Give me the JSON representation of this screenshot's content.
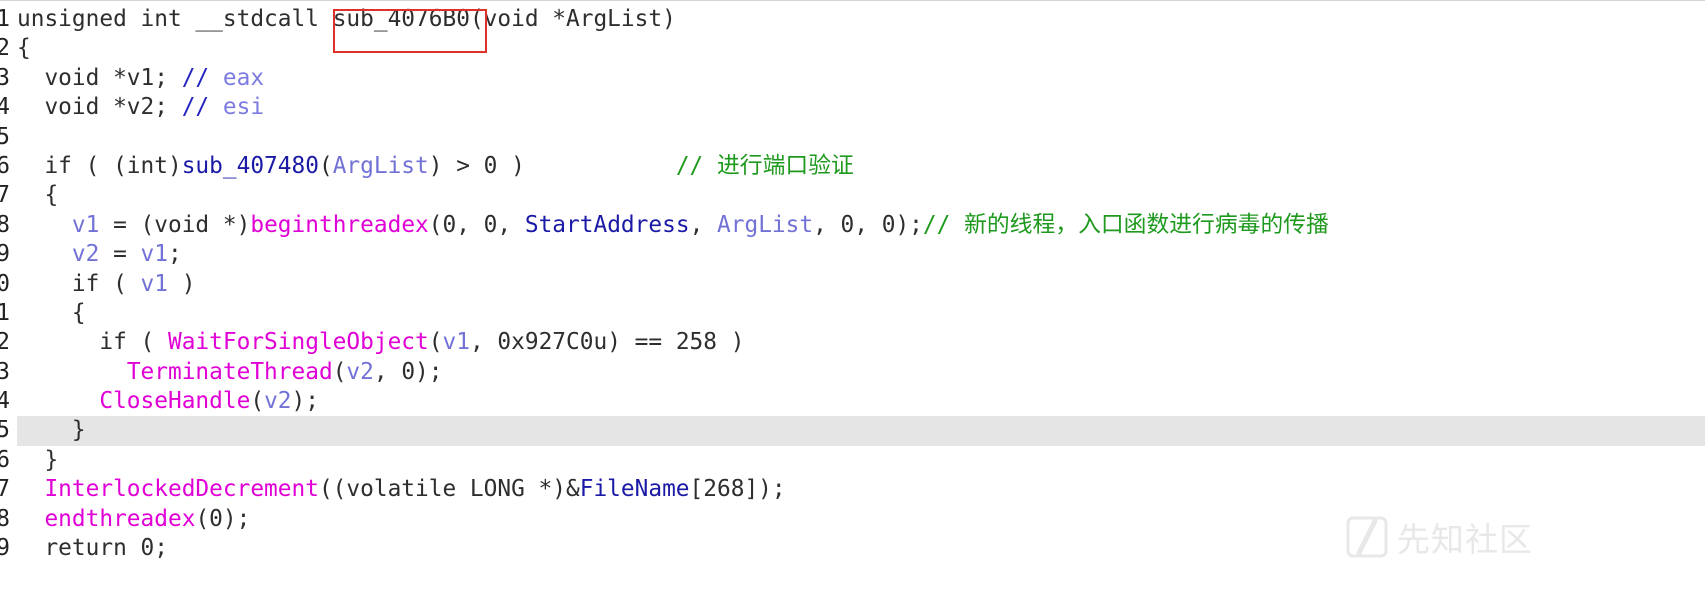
{
  "colors": {
    "plain": "#2e2e2e",
    "fname": "#2e2e2e",
    "name": "#1a1aa6",
    "import": "#e000d6",
    "var": "#7272d6",
    "comment": "#1f9a1f",
    "regslash": "#2323c0",
    "reg": "#7c7ce0",
    "highlight": "#e5e5e5",
    "annotation": "#e0302a",
    "watermark": "#e8e8e8"
  },
  "code": {
    "lines": [
      {
        "number": "1",
        "tokens": [
          {
            "plain": "unsigned int __stdcall "
          },
          {
            "fname": "sub_4076B0"
          },
          {
            "plain": "(void *ArgList)"
          }
        ]
      },
      {
        "number": "2",
        "tokens": [
          {
            "plain": "{"
          }
        ]
      },
      {
        "number": "3",
        "tokens": [
          {
            "plain": "  void *v1; "
          },
          {
            "regslash": "// "
          },
          {
            "reg": "eax"
          }
        ]
      },
      {
        "number": "4",
        "tokens": [
          {
            "plain": "  void *v2; "
          },
          {
            "regslash": "// "
          },
          {
            "reg": "esi"
          }
        ]
      },
      {
        "number": "5",
        "tokens": []
      },
      {
        "number": "6",
        "tokens": [
          {
            "plain": "  if ( (int)"
          },
          {
            "name": "sub_407480"
          },
          {
            "plain": "("
          },
          {
            "var": "ArgList"
          },
          {
            "plain": ") > 0 )           "
          },
          {
            "comment": "// 进行端口验证"
          }
        ]
      },
      {
        "number": "7",
        "tokens": [
          {
            "plain": "  {"
          }
        ]
      },
      {
        "number": "8",
        "tokens": [
          {
            "plain": "    "
          },
          {
            "var": "v1"
          },
          {
            "plain": " = (void *)"
          },
          {
            "import": "beginthreadex"
          },
          {
            "plain": "(0, 0, "
          },
          {
            "name": "StartAddress"
          },
          {
            "plain": ", "
          },
          {
            "var": "ArgList"
          },
          {
            "plain": ", 0, 0);"
          },
          {
            "comment": "// 新的线程，入口函数进行病毒的传播"
          }
        ]
      },
      {
        "number": "9",
        "tokens": [
          {
            "plain": "    "
          },
          {
            "var": "v2"
          },
          {
            "plain": " = "
          },
          {
            "var": "v1"
          },
          {
            "plain": ";"
          }
        ]
      },
      {
        "number": "0",
        "tokens": [
          {
            "plain": "    if ( "
          },
          {
            "var": "v1"
          },
          {
            "plain": " )"
          }
        ]
      },
      {
        "number": "1",
        "tokens": [
          {
            "plain": "    {"
          }
        ]
      },
      {
        "number": "2",
        "tokens": [
          {
            "plain": "      if ( "
          },
          {
            "import": "WaitForSingleObject"
          },
          {
            "plain": "("
          },
          {
            "var": "v1"
          },
          {
            "plain": ", 0x927C0u) == 258 )"
          }
        ]
      },
      {
        "number": "3",
        "tokens": [
          {
            "plain": "        "
          },
          {
            "import": "TerminateThread"
          },
          {
            "plain": "("
          },
          {
            "var": "v2"
          },
          {
            "plain": ", 0);"
          }
        ]
      },
      {
        "number": "4",
        "tokens": [
          {
            "plain": "      "
          },
          {
            "import": "CloseHandle"
          },
          {
            "plain": "("
          },
          {
            "var": "v2"
          },
          {
            "plain": ");"
          }
        ]
      },
      {
        "number": "5",
        "highlighted": true,
        "tokens": [
          {
            "plain": "    }"
          }
        ]
      },
      {
        "number": "6",
        "tokens": [
          {
            "plain": "  }"
          }
        ]
      },
      {
        "number": "7",
        "tokens": [
          {
            "plain": "  "
          },
          {
            "import": "InterlockedDecrement"
          },
          {
            "plain": "((volatile LONG *)&"
          },
          {
            "name": "FileName"
          },
          {
            "plain": "[268]);"
          }
        ]
      },
      {
        "number": "8",
        "tokens": [
          {
            "plain": "  "
          },
          {
            "import": "endthreadex"
          },
          {
            "plain": "(0);"
          }
        ]
      },
      {
        "number": "9",
        "tokens": [
          {
            "plain": "  return 0;"
          }
        ]
      }
    ]
  },
  "watermark": {
    "text": "先知社区"
  }
}
